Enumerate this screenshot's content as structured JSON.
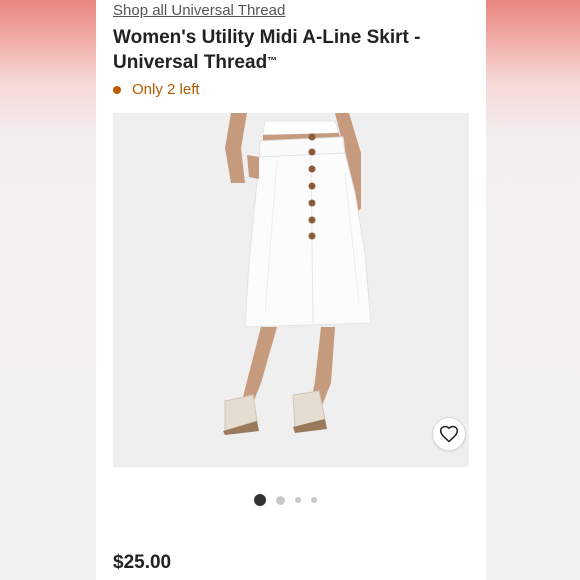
{
  "header": {
    "shop_link": "Shop all Universal Thread"
  },
  "product": {
    "title": "Women's Utility Midi A-Line Skirt - Universal Thread",
    "trademark": "™",
    "stock_status": "Only 2 left",
    "price": "$25.00"
  },
  "gallery": {
    "image_count": 4,
    "active_index": 0,
    "favorite_icon": "heart-outline-icon"
  },
  "colors": {
    "stock": "#c35a00",
    "title": "#222222",
    "active_dot": "#333333"
  }
}
